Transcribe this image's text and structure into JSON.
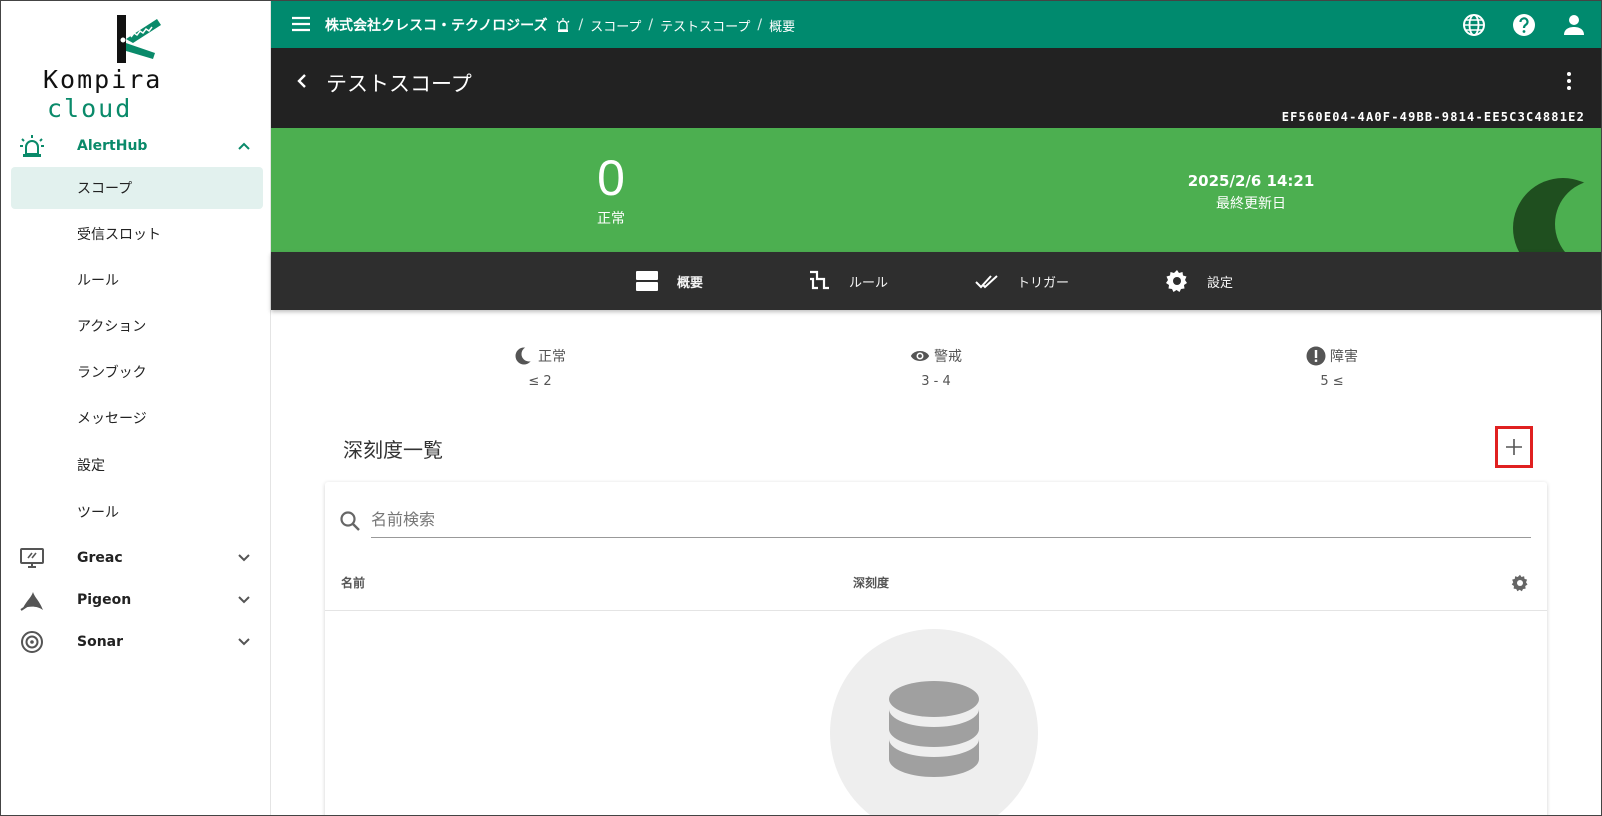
{
  "brand": {
    "logo_word": "Kompira",
    "logo_accent": "cloud"
  },
  "sidebar": {
    "sections": [
      {
        "label": "AlertHub",
        "expanded": true,
        "icon": "alarm-light-icon"
      },
      {
        "label": "Greac",
        "expanded": false,
        "icon": "monitor-icon"
      },
      {
        "label": "Pigeon",
        "expanded": false,
        "icon": "pigeon-icon"
      },
      {
        "label": "Sonar",
        "expanded": false,
        "icon": "sonar-icon"
      }
    ],
    "alerthub_items": [
      {
        "label": "スコープ",
        "active": true
      },
      {
        "label": "受信スロット"
      },
      {
        "label": "ルール"
      },
      {
        "label": "アクション"
      },
      {
        "label": "ランブック"
      },
      {
        "label": "メッセージ"
      },
      {
        "label": "設定"
      },
      {
        "label": "ツール"
      }
    ]
  },
  "topbar": {
    "organization": "株式会社クレスコ・テクノロジーズ",
    "breadcrumbs": [
      "スコープ",
      "テストスコープ",
      "概要"
    ],
    "icons": [
      "globe-icon",
      "help-icon",
      "account-icon"
    ]
  },
  "scope": {
    "title": "テストスコープ",
    "id": "EF560E04-4A0F-49BB-9814-EE5C3C4881E2"
  },
  "status": {
    "count": "0",
    "label": "正常",
    "updated_at": "2025/2/6 14:21",
    "updated_label": "最終更新日"
  },
  "tabs": [
    {
      "label": "概要",
      "icon": "view-agenda-icon",
      "active": true
    },
    {
      "label": "ルール",
      "icon": "source-branch-icon"
    },
    {
      "label": "トリガー",
      "icon": "check-all-icon"
    },
    {
      "label": "設定",
      "icon": "gear-icon"
    }
  ],
  "legend": [
    {
      "label": "正常",
      "range": "≤ 2",
      "icon": "moon-icon"
    },
    {
      "label": "警戒",
      "range": "3 - 4",
      "icon": "eye-icon"
    },
    {
      "label": "障害",
      "range": "5 ≤",
      "icon": "alert-circle-icon"
    }
  ],
  "severity_list": {
    "title": "深刻度一覧",
    "search_placeholder": "名前検索",
    "columns": [
      "名前",
      "深刻度"
    ]
  },
  "colors": {
    "topbar": "#008a6e",
    "titlebar": "#222222",
    "status_normal": "#4caf50",
    "tabs": "#2e2e2e",
    "highlight": "#e02020"
  }
}
